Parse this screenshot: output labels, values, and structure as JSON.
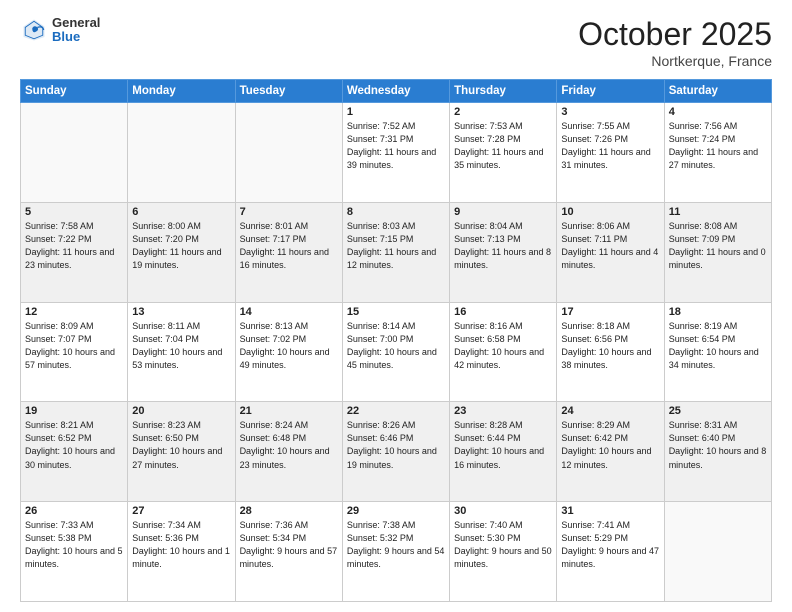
{
  "header": {
    "logo": {
      "general": "General",
      "blue": "Blue"
    },
    "title": "October 2025",
    "location": "Nortkerque, France"
  },
  "calendar": {
    "days_of_week": [
      "Sunday",
      "Monday",
      "Tuesday",
      "Wednesday",
      "Thursday",
      "Friday",
      "Saturday"
    ],
    "weeks": [
      {
        "shade": "white",
        "days": [
          {
            "number": "",
            "info": ""
          },
          {
            "number": "",
            "info": ""
          },
          {
            "number": "",
            "info": ""
          },
          {
            "number": "1",
            "info": "Sunrise: 7:52 AM\nSunset: 7:31 PM\nDaylight: 11 hours\nand 39 minutes."
          },
          {
            "number": "2",
            "info": "Sunrise: 7:53 AM\nSunset: 7:28 PM\nDaylight: 11 hours\nand 35 minutes."
          },
          {
            "number": "3",
            "info": "Sunrise: 7:55 AM\nSunset: 7:26 PM\nDaylight: 11 hours\nand 31 minutes."
          },
          {
            "number": "4",
            "info": "Sunrise: 7:56 AM\nSunset: 7:24 PM\nDaylight: 11 hours\nand 27 minutes."
          }
        ]
      },
      {
        "shade": "shaded",
        "days": [
          {
            "number": "5",
            "info": "Sunrise: 7:58 AM\nSunset: 7:22 PM\nDaylight: 11 hours\nand 23 minutes."
          },
          {
            "number": "6",
            "info": "Sunrise: 8:00 AM\nSunset: 7:20 PM\nDaylight: 11 hours\nand 19 minutes."
          },
          {
            "number": "7",
            "info": "Sunrise: 8:01 AM\nSunset: 7:17 PM\nDaylight: 11 hours\nand 16 minutes."
          },
          {
            "number": "8",
            "info": "Sunrise: 8:03 AM\nSunset: 7:15 PM\nDaylight: 11 hours\nand 12 minutes."
          },
          {
            "number": "9",
            "info": "Sunrise: 8:04 AM\nSunset: 7:13 PM\nDaylight: 11 hours\nand 8 minutes."
          },
          {
            "number": "10",
            "info": "Sunrise: 8:06 AM\nSunset: 7:11 PM\nDaylight: 11 hours\nand 4 minutes."
          },
          {
            "number": "11",
            "info": "Sunrise: 8:08 AM\nSunset: 7:09 PM\nDaylight: 11 hours\nand 0 minutes."
          }
        ]
      },
      {
        "shade": "white",
        "days": [
          {
            "number": "12",
            "info": "Sunrise: 8:09 AM\nSunset: 7:07 PM\nDaylight: 10 hours\nand 57 minutes."
          },
          {
            "number": "13",
            "info": "Sunrise: 8:11 AM\nSunset: 7:04 PM\nDaylight: 10 hours\nand 53 minutes."
          },
          {
            "number": "14",
            "info": "Sunrise: 8:13 AM\nSunset: 7:02 PM\nDaylight: 10 hours\nand 49 minutes."
          },
          {
            "number": "15",
            "info": "Sunrise: 8:14 AM\nSunset: 7:00 PM\nDaylight: 10 hours\nand 45 minutes."
          },
          {
            "number": "16",
            "info": "Sunrise: 8:16 AM\nSunset: 6:58 PM\nDaylight: 10 hours\nand 42 minutes."
          },
          {
            "number": "17",
            "info": "Sunrise: 8:18 AM\nSunset: 6:56 PM\nDaylight: 10 hours\nand 38 minutes."
          },
          {
            "number": "18",
            "info": "Sunrise: 8:19 AM\nSunset: 6:54 PM\nDaylight: 10 hours\nand 34 minutes."
          }
        ]
      },
      {
        "shade": "shaded",
        "days": [
          {
            "number": "19",
            "info": "Sunrise: 8:21 AM\nSunset: 6:52 PM\nDaylight: 10 hours\nand 30 minutes."
          },
          {
            "number": "20",
            "info": "Sunrise: 8:23 AM\nSunset: 6:50 PM\nDaylight: 10 hours\nand 27 minutes."
          },
          {
            "number": "21",
            "info": "Sunrise: 8:24 AM\nSunset: 6:48 PM\nDaylight: 10 hours\nand 23 minutes."
          },
          {
            "number": "22",
            "info": "Sunrise: 8:26 AM\nSunset: 6:46 PM\nDaylight: 10 hours\nand 19 minutes."
          },
          {
            "number": "23",
            "info": "Sunrise: 8:28 AM\nSunset: 6:44 PM\nDaylight: 10 hours\nand 16 minutes."
          },
          {
            "number": "24",
            "info": "Sunrise: 8:29 AM\nSunset: 6:42 PM\nDaylight: 10 hours\nand 12 minutes."
          },
          {
            "number": "25",
            "info": "Sunrise: 8:31 AM\nSunset: 6:40 PM\nDaylight: 10 hours\nand 8 minutes."
          }
        ]
      },
      {
        "shade": "white",
        "days": [
          {
            "number": "26",
            "info": "Sunrise: 7:33 AM\nSunset: 5:38 PM\nDaylight: 10 hours\nand 5 minutes."
          },
          {
            "number": "27",
            "info": "Sunrise: 7:34 AM\nSunset: 5:36 PM\nDaylight: 10 hours\nand 1 minute."
          },
          {
            "number": "28",
            "info": "Sunrise: 7:36 AM\nSunset: 5:34 PM\nDaylight: 9 hours\nand 57 minutes."
          },
          {
            "number": "29",
            "info": "Sunrise: 7:38 AM\nSunset: 5:32 PM\nDaylight: 9 hours\nand 54 minutes."
          },
          {
            "number": "30",
            "info": "Sunrise: 7:40 AM\nSunset: 5:30 PM\nDaylight: 9 hours\nand 50 minutes."
          },
          {
            "number": "31",
            "info": "Sunrise: 7:41 AM\nSunset: 5:29 PM\nDaylight: 9 hours\nand 47 minutes."
          },
          {
            "number": "",
            "info": ""
          }
        ]
      }
    ]
  }
}
